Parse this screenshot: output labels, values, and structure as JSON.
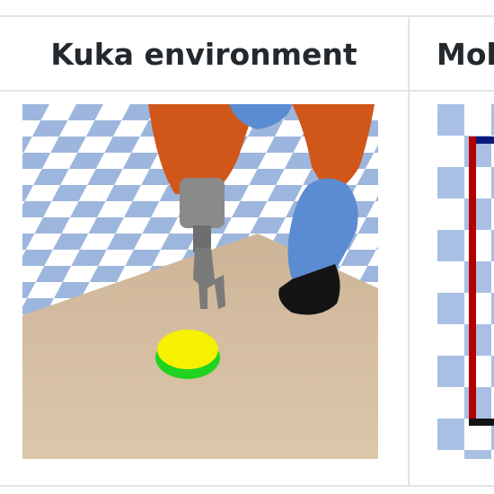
{
  "table": {
    "columns": [
      {
        "header": "Kuka environment",
        "image": "kuka-robot-arm-scene"
      },
      {
        "header": "Mol",
        "image": "maze-grid-scene"
      }
    ]
  },
  "colors": {
    "border": "#e1e4e8",
    "header_text": "#24292e",
    "floor_tile_light": "#ffffff",
    "floor_tile_blue": "#9db6dd",
    "tray": "#d6bea0",
    "robot_orange": "#d1561a",
    "robot_blue": "#5b8bd1",
    "gripper_grey": "#7a7a7a",
    "target_yellow": "#f6f003",
    "target_green": "#21d321",
    "maze_red": "#b50000",
    "maze_navy": "#0b1a7a"
  }
}
